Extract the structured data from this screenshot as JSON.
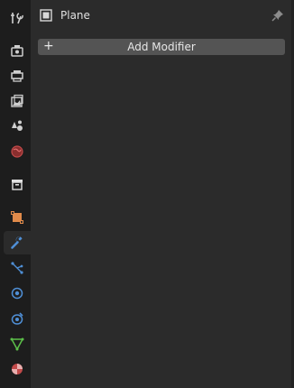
{
  "header": {
    "object_name": "Plane"
  },
  "modifier_panel": {
    "add_label": "Add Modifier",
    "plus_glyph": "+"
  },
  "tabs": [
    {
      "name": "tool-icon",
      "active": false
    },
    {
      "name": "render-icon",
      "active": false
    },
    {
      "name": "output-icon",
      "active": false
    },
    {
      "name": "view-layer-icon",
      "active": false
    },
    {
      "name": "scene-icon",
      "active": false
    },
    {
      "name": "world-icon",
      "active": false
    },
    {
      "name": "collection-icon",
      "active": false
    },
    {
      "name": "object-icon",
      "active": false
    },
    {
      "name": "modifier-wrench-icon",
      "active": true
    },
    {
      "name": "particles-icon",
      "active": false
    },
    {
      "name": "physics-icon",
      "active": false
    },
    {
      "name": "constraints-icon",
      "active": false
    },
    {
      "name": "data-mesh-icon",
      "active": false
    },
    {
      "name": "material-icon",
      "active": false
    }
  ],
  "colors": {
    "tabbar_bg": "#1d1d1d",
    "panel_bg": "#2b2b2b",
    "button_bg": "#545454",
    "accent_blue": "#4f8fd6",
    "accent_orange": "#e08a4a",
    "accent_green": "#5cc04a",
    "accent_red": "#c24a4a"
  }
}
